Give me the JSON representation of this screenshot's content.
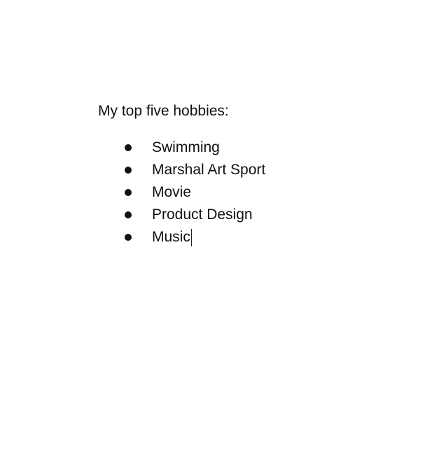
{
  "document": {
    "heading": "My top five hobbies:",
    "list": {
      "bullet_icon": "bullet-dot-icon",
      "items": [
        {
          "label": "Swimming"
        },
        {
          "label": "Marshal Art Sport"
        },
        {
          "label": "Movie"
        },
        {
          "label": "Product Design"
        },
        {
          "label": "Music"
        }
      ]
    },
    "caret_item_index": 4
  },
  "colors": {
    "background": "#ffffff",
    "text": "#111111"
  }
}
